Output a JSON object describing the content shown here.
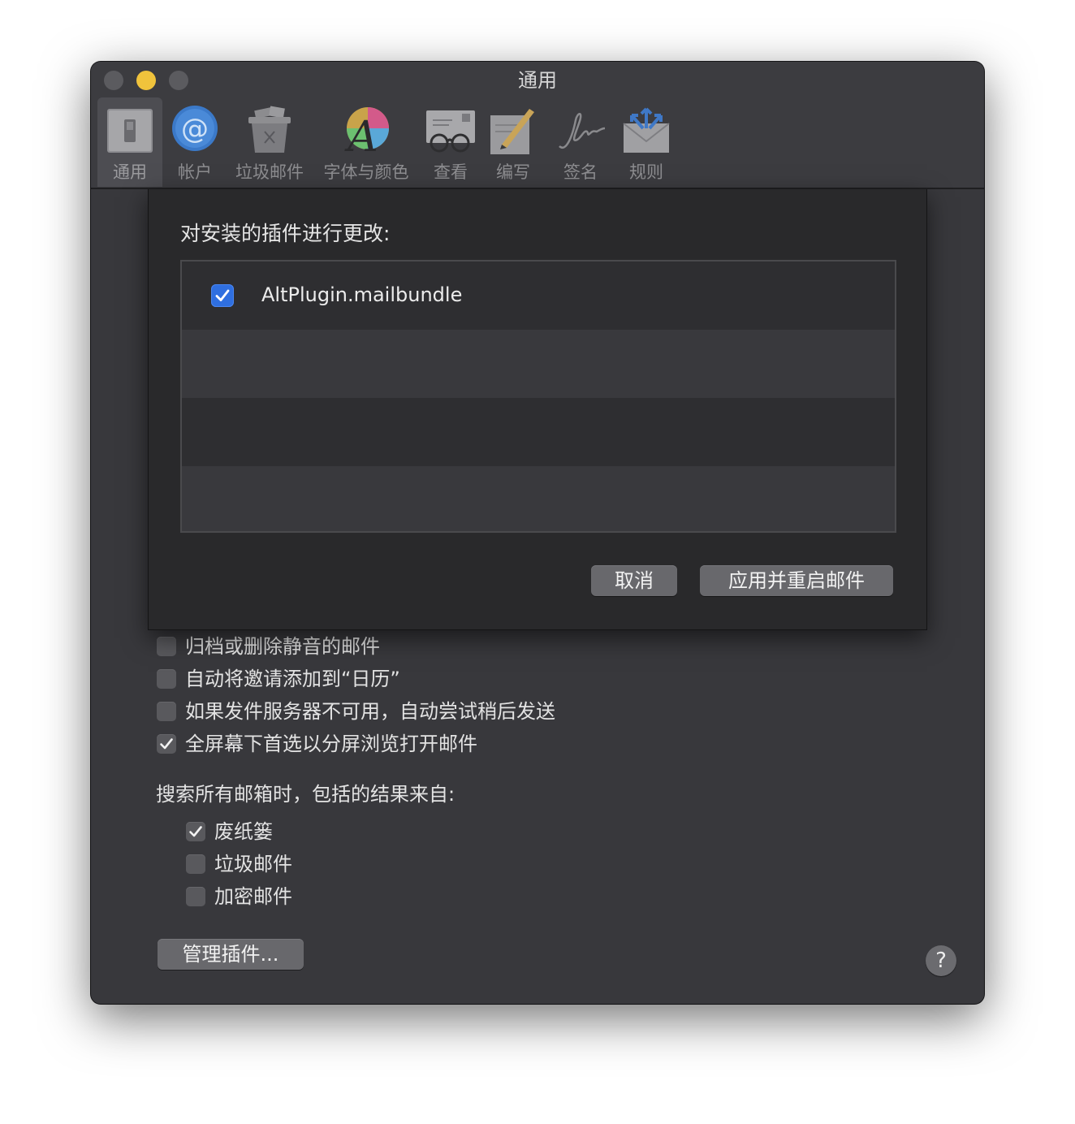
{
  "window": {
    "title": "通用"
  },
  "toolbar": {
    "tabs": [
      {
        "label": "通用",
        "icon": "general-switch-icon",
        "active": true
      },
      {
        "label": "帐户",
        "icon": "accounts-at-icon",
        "active": false
      },
      {
        "label": "垃圾邮件",
        "icon": "junk-bin-icon",
        "active": false
      },
      {
        "label": "字体与颜色",
        "icon": "fonts-colors-icon",
        "active": false
      },
      {
        "label": "查看",
        "icon": "viewing-glasses-icon",
        "active": false
      },
      {
        "label": "编写",
        "icon": "composing-pencil-icon",
        "active": false
      },
      {
        "label": "签名",
        "icon": "signature-icon",
        "active": false
      },
      {
        "label": "规则",
        "icon": "rules-envelope-icon",
        "active": false
      }
    ]
  },
  "sheet": {
    "title": "对安装的插件进行更改:",
    "plugins": [
      {
        "name": "AltPlugin.mailbundle",
        "checked": true
      }
    ],
    "cancel_label": "取消",
    "apply_label": "应用并重启邮件"
  },
  "general": {
    "options": [
      {
        "label": "归档或删除静音的邮件",
        "checked": false
      },
      {
        "label": "自动将邀请添加到“日历”",
        "checked": false
      },
      {
        "label": "如果发件服务器不可用，自动尝试稍后发送",
        "checked": false
      },
      {
        "label": "全屏幕下首选以分屏浏览打开邮件",
        "checked": true
      }
    ],
    "search_label": "搜索所有邮箱时，包括的结果来自:",
    "search_options": [
      {
        "label": "废纸篓",
        "checked": true
      },
      {
        "label": "垃圾邮件",
        "checked": false
      },
      {
        "label": "加密邮件",
        "checked": false
      }
    ],
    "manage_plugins_label": "管理插件...",
    "help_label": "?"
  },
  "colors": {
    "accent": "#2f6fe0",
    "window_bg": "#38383c",
    "sheet_bg": "#29292b",
    "minimize_light": "#f0c33c"
  }
}
